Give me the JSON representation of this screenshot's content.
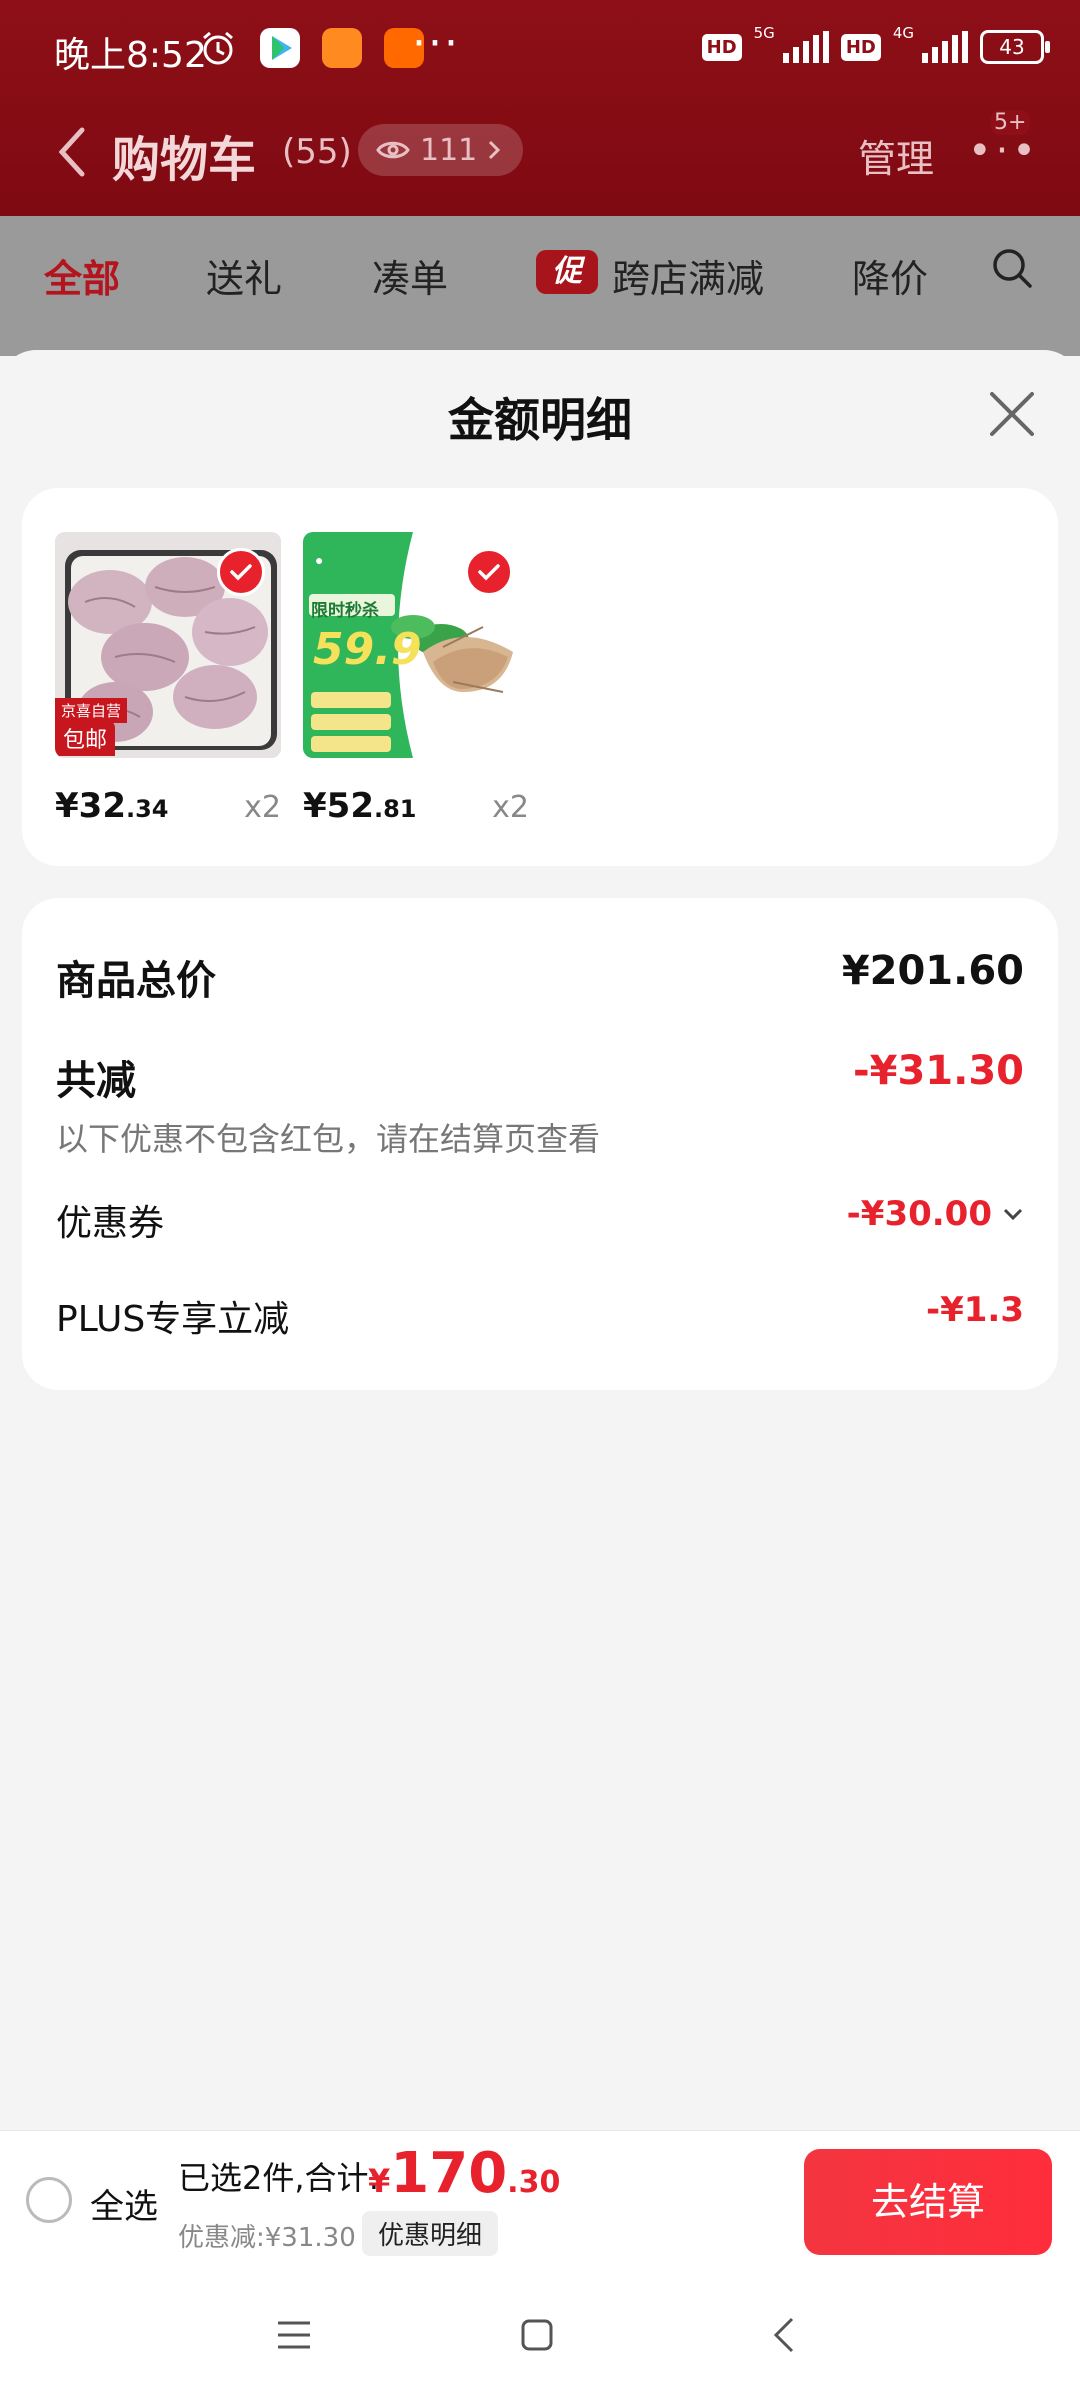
{
  "status_bar": {
    "time": "晚上8:52",
    "more": "···",
    "hd": "HD",
    "net1": "5G",
    "net2": "4G",
    "battery": "43"
  },
  "navbar": {
    "title": "购物车",
    "count": "(55)",
    "views": "111",
    "manage": "管理",
    "more": "•·•",
    "badge": "5+"
  },
  "tabs": [
    "全部",
    "送礼",
    "凑单",
    "跨店满减",
    "降价"
  ],
  "promo_tag": "促",
  "sheet": {
    "title": "金额明细",
    "products": [
      {
        "price_int": "¥32",
        "price_dec": ".34",
        "qty": "x2",
        "tag_top": "京喜自营",
        "tag_bottom": "包邮"
      },
      {
        "price_int": "¥52",
        "price_dec": ".81",
        "qty": "x2",
        "badge_text": "限时秒杀",
        "big_num": "59.9"
      }
    ],
    "summary": {
      "total_label": "商品总价",
      "total_value": "¥201.60",
      "discount_label": "共减",
      "discount_value": "-¥31.30",
      "note": "以下优惠不包含红包，请在结算页查看",
      "coupon_label": "优惠券",
      "coupon_value": "-¥30.00",
      "plus_label": "PLUS专享立减",
      "plus_value": "-¥1.3"
    }
  },
  "bottom_bar": {
    "select_all": "全选",
    "selected_text": "已选2件,合计:",
    "currency": "¥",
    "total_int": "170",
    "total_dec": ".30",
    "discount_text": "优惠减:¥31.30",
    "detail_button": "优惠明细",
    "checkout": "去结算"
  },
  "colors": {
    "accent": "#e8222d",
    "header": "#8e0f17"
  }
}
